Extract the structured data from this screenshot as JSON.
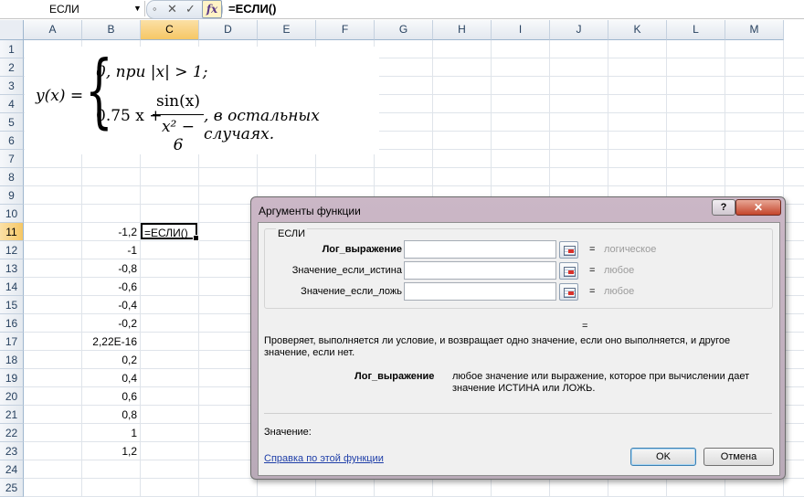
{
  "formula_bar": {
    "name_box": "ЕСЛИ",
    "fx_label": "fx",
    "cancel_icon": "✕",
    "enter_icon": "✓",
    "content": "=ЕСЛИ()"
  },
  "columns": [
    "A",
    "B",
    "C",
    "D",
    "E",
    "F",
    "G",
    "H",
    "I",
    "J",
    "K",
    "L",
    "M"
  ],
  "selected_column": "C",
  "rows": [
    "1",
    "2",
    "3",
    "4",
    "5",
    "6",
    "7",
    "8",
    "9",
    "10",
    "11",
    "12",
    "13",
    "14",
    "15",
    "16",
    "17",
    "18",
    "19",
    "20",
    "21",
    "22",
    "23",
    "24",
    "25"
  ],
  "selected_row": "11",
  "column_b_values": [
    "-1,2",
    "-1",
    "-0,8",
    "-0,6",
    "-0,4",
    "-0,2",
    "2,22E-16",
    "0,2",
    "0,4",
    "0,6",
    "0,8",
    "1",
    "1,2"
  ],
  "active_cell": {
    "ref": "C11",
    "text": "=ЕСЛИ()"
  },
  "formula_image": {
    "lhs": "y(x) =",
    "case1": "0, при |x| > 1;",
    "case2_prefix": "0.75 x +",
    "frac_num": "sin(x)",
    "frac_den": "x² − 6",
    "case2_suffix": ", в остальных случаях."
  },
  "dialog": {
    "title": "Аргументы функции",
    "help_icon": "?",
    "close_icon": "✕",
    "group_label": "ЕСЛИ",
    "args": [
      {
        "label": "Лог_выражение",
        "value": "",
        "result": "логическое",
        "bold": true
      },
      {
        "label": "Значение_если_истина",
        "value": "",
        "result": "любое",
        "bold": false
      },
      {
        "label": "Значение_если_ложь",
        "value": "",
        "result": "любое",
        "bold": false
      }
    ],
    "equals_sign": "=",
    "description": "Проверяет, выполняется ли условие, и возвращает одно значение, если оно выполняется, и другое значение, если нет.",
    "arg_detail_name": "Лог_выражение",
    "arg_detail_text": "любое значение или выражение, которое при вычислении дает значение ИСТИНА или ЛОЖЬ.",
    "value_label": "Значение:",
    "help_link": "Справка по этой функции",
    "ok_label": "OK",
    "cancel_label": "Отмена"
  }
}
